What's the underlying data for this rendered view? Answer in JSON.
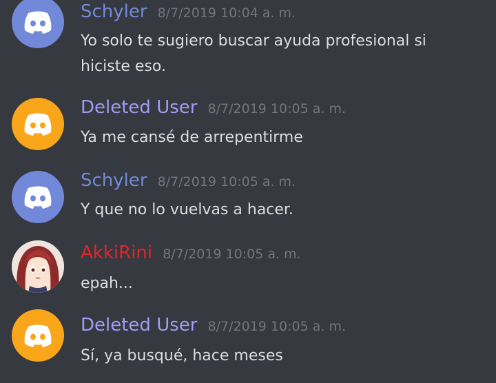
{
  "colors": {
    "background": "#36393f",
    "message_text": "#dcddde",
    "timestamp": "#72767d",
    "schyler_name": "#7289da",
    "deleted_user_name": "#a29af3",
    "akkirini_name": "#e0262b",
    "blurple_avatar": "#7289da",
    "orange_avatar": "#faa61a"
  },
  "messages": [
    {
      "username": "Schyler",
      "timestamp": "8/7/2019 10:04 a. m.",
      "text": "Yo solo te sugiero buscar ayuda profesional si hiciste eso.",
      "avatar_icon": "discord-logo-icon",
      "avatar_color": "#7289da"
    },
    {
      "username": "Deleted User",
      "timestamp": "8/7/2019 10:05 a. m.",
      "text": "Ya me cansé de arrepentirme",
      "avatar_icon": "discord-logo-icon",
      "avatar_color": "#faa61a"
    },
    {
      "username": "Schyler",
      "timestamp": "8/7/2019 10:05 a. m.",
      "text": "Y que no lo vuelvas a hacer.",
      "avatar_icon": "discord-logo-icon",
      "avatar_color": "#7289da"
    },
    {
      "username": "AkkiRini",
      "timestamp": "8/7/2019 10:05 a. m.",
      "text": "epah...",
      "avatar_icon": "anime-girl-avatar-icon"
    },
    {
      "username": "Deleted User",
      "timestamp": "8/7/2019 10:05 a. m.",
      "text": "Sí, ya busqué, hace meses",
      "avatar_icon": "discord-logo-icon",
      "avatar_color": "#faa61a"
    }
  ]
}
